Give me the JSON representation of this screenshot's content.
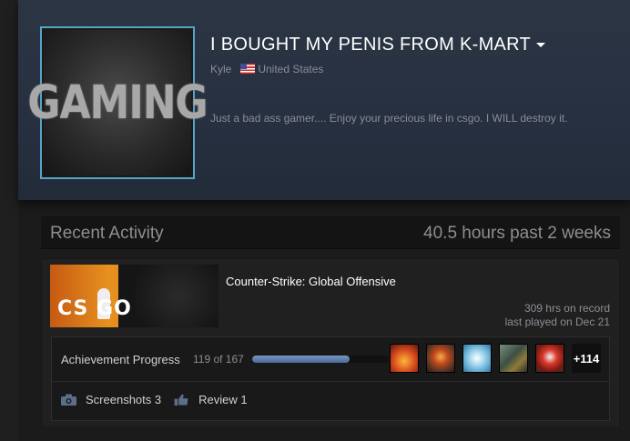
{
  "profile": {
    "persona_name": "I BOUGHT MY PENIS FROM K-MART",
    "real_name": "Kyle",
    "country": "United States",
    "summary": "Just a bad ass gamer.... Enjoy your precious life in csgo. I WILL destroy it.",
    "avatar_text": "GAMING"
  },
  "recent_activity": {
    "title": "Recent Activity",
    "hours_past": "40.5 hours past 2 weeks"
  },
  "game": {
    "name": "Counter-Strike: Global Offensive",
    "capsule_logo": "CS GO",
    "hours_on_record": "309 hrs on record",
    "last_played": "last played on Dec 21",
    "achievements": {
      "label": "Achievement Progress",
      "count": "119 of 167",
      "progress_fraction": 0.713,
      "more": "+114",
      "icons": [
        "achievement-fire-icon",
        "achievement-medal-icon",
        "achievement-badge-icon",
        "achievement-bomb-icon",
        "achievement-ribbon-icon"
      ]
    },
    "screenshots": "Screenshots 3",
    "review": "Review 1"
  },
  "colors": {
    "accent_border": "#57a4c6",
    "progress_fill": "#5f80b0",
    "header_bg": "#2c3544"
  }
}
